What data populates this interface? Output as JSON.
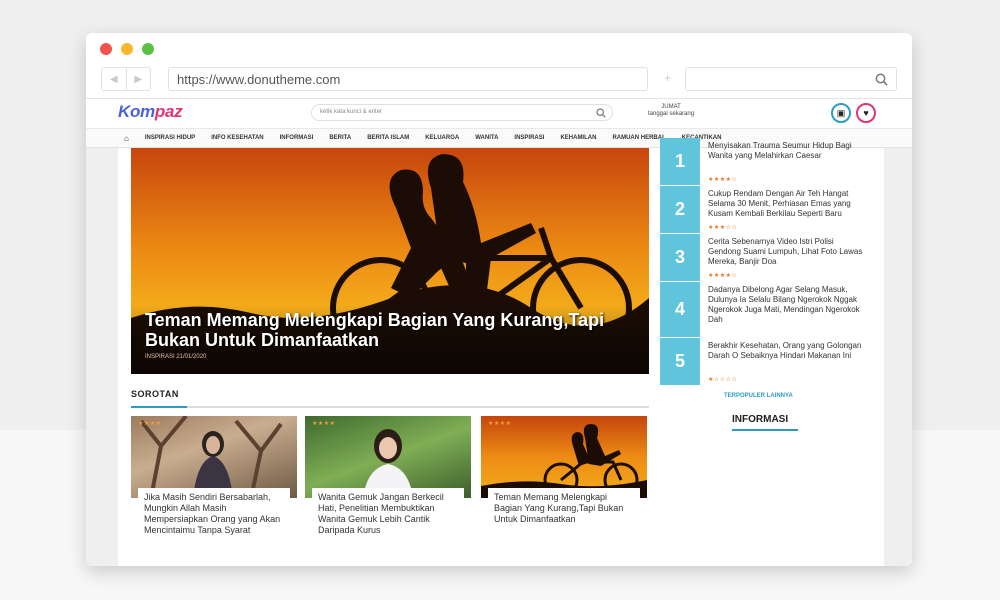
{
  "browser": {
    "url": "https://www.donutheme.com"
  },
  "site": {
    "logo_a": "Kom",
    "logo_b": "paz",
    "search_placeholder": "ketik kata kunci & enter",
    "date_line1": "JUMAT",
    "date_line2": "tanggal sekarang"
  },
  "menu": {
    "home_icon": "⌂",
    "items": [
      "INSPIRASI HIDUP",
      "INFO KESEHATAN",
      "INFORMASI",
      "BERITA",
      "BERITA ISLAM",
      "KELUARGA",
      "WANITA",
      "INSPIRASI",
      "KEHAMILAN",
      "RAMUAN HERBAL",
      "KECANTIKAN"
    ]
  },
  "hero": {
    "title": "Teman Memang Melengkapi Bagian Yang Kurang,Tapi Bukan Untuk Dimanfaatkan",
    "meta": "INSPIRASI 21/01/2020"
  },
  "ranking": [
    {
      "num": "1",
      "text": "Menyisakan Trauma Seumur Hidup Bagi Wanita yang Melahirkan Caesar",
      "stars": "★★★★☆"
    },
    {
      "num": "2",
      "text": "Cukup Rendam Dengan Air Teh Hangat Selama 30 Menit, Perhiasan Emas yang Kusam Kembali Berkilau Seperti Baru",
      "stars": "★★★☆☆"
    },
    {
      "num": "3",
      "text": "Cerita Sebenarnya Video Istri Polisi Gendong Suami Lumpuh, Lihat Foto Lawas Mereka, Banjir Doa",
      "stars": "★★★★☆"
    },
    {
      "num": "4",
      "text": "Dadanya Dibelong Agar Selang Masuk, Dulunya Ia Selalu Bilang Ngerokok Nggak Ngerokok Juga Mati, Mendingan Ngerokok Dah",
      "stars": "★★★★☆"
    },
    {
      "num": "5",
      "text": "Berakhir Kesehatan, Orang yang Golongan Darah O Sebaiknya Hindari Makanan Ini",
      "stars": "★☆☆☆☆"
    }
  ],
  "popular_label": "TERPOPULER LAINNYA",
  "sorotan_label": "SOROTAN",
  "informasi_label": "INFORMASI",
  "cards": [
    {
      "badge": "★★★★",
      "caption": "Jika Masih Sendiri Bersabarlah, Mungkin Allah Masih Mempersiapkan Orang yang Akan Mencintaimu Tanpa Syarat"
    },
    {
      "badge": "★★★★",
      "caption": "Wanita Gemuk Jangan Berkecil Hati, Penelitian Membuktikan Wanita Gemuk Lebih Cantik Daripada Kurus"
    },
    {
      "badge": "★★★★",
      "caption": "Teman Memang Melengkapi Bagian Yang Kurang,Tapi Bukan Untuk Dimanfaatkan"
    }
  ]
}
